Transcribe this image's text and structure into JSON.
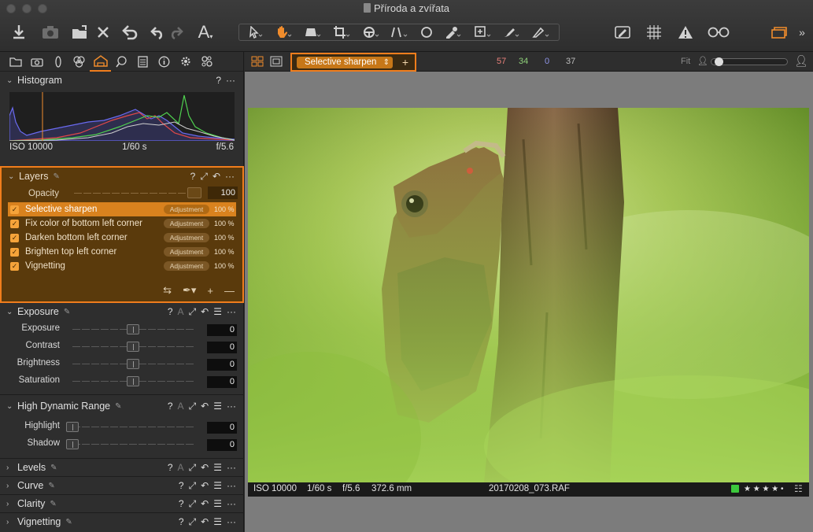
{
  "window": {
    "title": "Příroda a zvířata"
  },
  "toolbar": {
    "text_tool_label": "A"
  },
  "left_panel": {
    "histogram": {
      "title": "Histogram",
      "iso": "ISO 10000",
      "shutter": "1/60 s",
      "aperture": "f/5.6"
    },
    "layers": {
      "title": "Layers",
      "opacity_label": "Opacity",
      "opacity_value": "100",
      "items": [
        {
          "name": "Selective sharpen",
          "type": "Adjustment",
          "opacity": "100 %",
          "selected": true
        },
        {
          "name": "Fix color of bottom left corner",
          "type": "Adjustment",
          "opacity": "100 %",
          "selected": false
        },
        {
          "name": "Darken bottom left corner",
          "type": "Adjustment",
          "opacity": "100 %",
          "selected": false
        },
        {
          "name": "Brighten top left corner",
          "type": "Adjustment",
          "opacity": "100 %",
          "selected": false
        },
        {
          "name": "Vignetting",
          "type": "Adjustment",
          "opacity": "100 %",
          "selected": false
        }
      ]
    },
    "exposure": {
      "title": "Exposure",
      "sliders": [
        {
          "label": "Exposure",
          "value": "0",
          "level": 0.5
        },
        {
          "label": "Contrast",
          "value": "0",
          "level": 0.5
        },
        {
          "label": "Brightness",
          "value": "0",
          "level": 0.5
        },
        {
          "label": "Saturation",
          "value": "0",
          "level": 0.5
        }
      ]
    },
    "hdr": {
      "title": "High Dynamic Range",
      "sliders": [
        {
          "label": "Highlight",
          "value": "0",
          "level": 0
        },
        {
          "label": "Shadow",
          "value": "0",
          "level": 0
        }
      ]
    },
    "collapsed_sections": [
      "Levels",
      "Curve",
      "Clarity",
      "Vignetting"
    ]
  },
  "viewer": {
    "layer_select": "Selective sharpen",
    "color_readout": {
      "r": "57",
      "g": "34",
      "b": "0",
      "l": "37"
    },
    "zoom_label": "Fit",
    "photo_info": {
      "iso": "ISO 10000",
      "shutter": "1/60 s",
      "aperture": "f/5.6",
      "focal_length": "372.6 mm",
      "filename": "20170208_073.RAF",
      "rating": "★ ★ ★ ★ •"
    }
  },
  "colors": {
    "accent": "#f07d1c",
    "layers_bg": "#5a3a0c",
    "selected_layer": "#d9821e",
    "color_tag": "#3cc83c",
    "readout_r": "#e8807a",
    "readout_g": "#8fd17a",
    "readout_b": "#8f95e8",
    "readout_l": "#bdbdbd"
  }
}
